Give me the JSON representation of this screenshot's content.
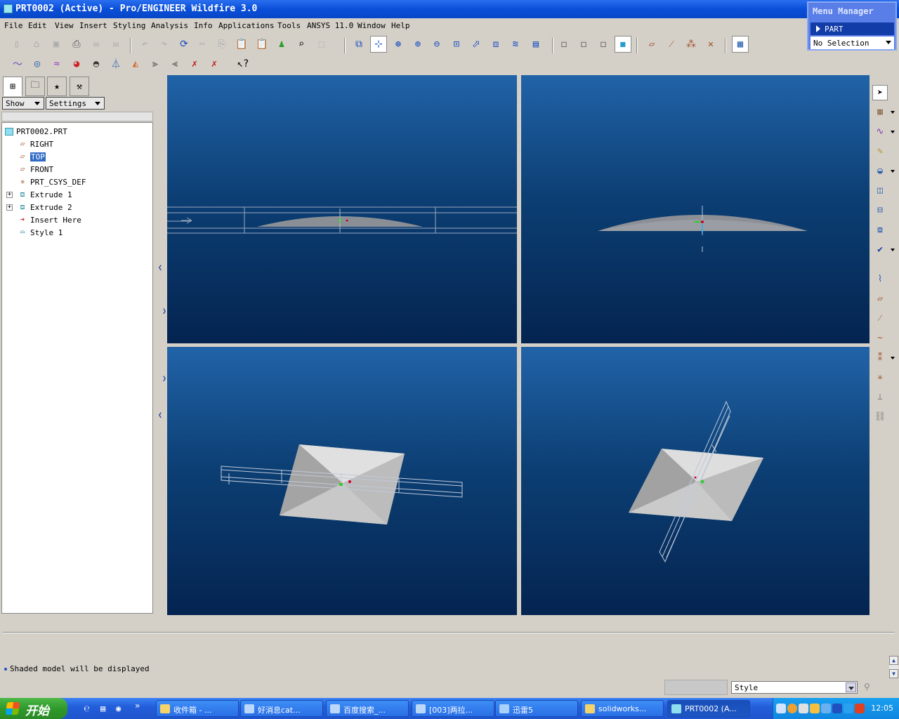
{
  "window": {
    "title": "PRT0002 (Active) - Pro/ENGINEER Wildfire 3.0"
  },
  "menu_manager": {
    "title": "Menu Manager",
    "item": "PART",
    "selection": "No Selection"
  },
  "menubar": [
    "File",
    "Edit",
    "View",
    "Insert",
    "Styling",
    "Analysis",
    "Info",
    "Applications",
    "Tools",
    "ANSYS 11.0",
    "Window",
    "Help"
  ],
  "navigator": {
    "show_label": "Show",
    "settings_label": "Settings",
    "tree": [
      {
        "label": "PRT0002.PRT",
        "icon": "part-icon",
        "level": 0
      },
      {
        "label": "RIGHT",
        "icon": "datum-plane-icon",
        "level": 1
      },
      {
        "label": "TOP",
        "icon": "datum-plane-icon",
        "level": 1,
        "selected": true
      },
      {
        "label": "FRONT",
        "icon": "datum-plane-icon",
        "level": 1
      },
      {
        "label": "PRT_CSYS_DEF",
        "icon": "csys-icon",
        "level": 1
      },
      {
        "label": "Extrude 1",
        "icon": "extrude-icon",
        "level": 1,
        "expandable": true
      },
      {
        "label": "Extrude 2",
        "icon": "extrude-icon",
        "level": 1,
        "expandable": true
      },
      {
        "label": "Insert Here",
        "icon": "insert-arrow-icon",
        "level": 1
      },
      {
        "label": "Style 1",
        "icon": "style-icon",
        "level": 1
      }
    ]
  },
  "message": {
    "text": "Shaded model will be displayed"
  },
  "filter": {
    "value": "Style"
  },
  "taskbar": {
    "start_label": "开始",
    "tasks": [
      "收件箱 - ...",
      "好消息cat...",
      "百度搜索_...",
      "[003]两拉...",
      "迅雷5",
      "solidworks...",
      "PRT0002 (A..."
    ],
    "clock": "12:05"
  },
  "colors": {
    "viewport_top": "#2163a8",
    "viewport_bottom": "#042450",
    "selection": "#316ac5",
    "titlebar": "#0a4fd8"
  }
}
